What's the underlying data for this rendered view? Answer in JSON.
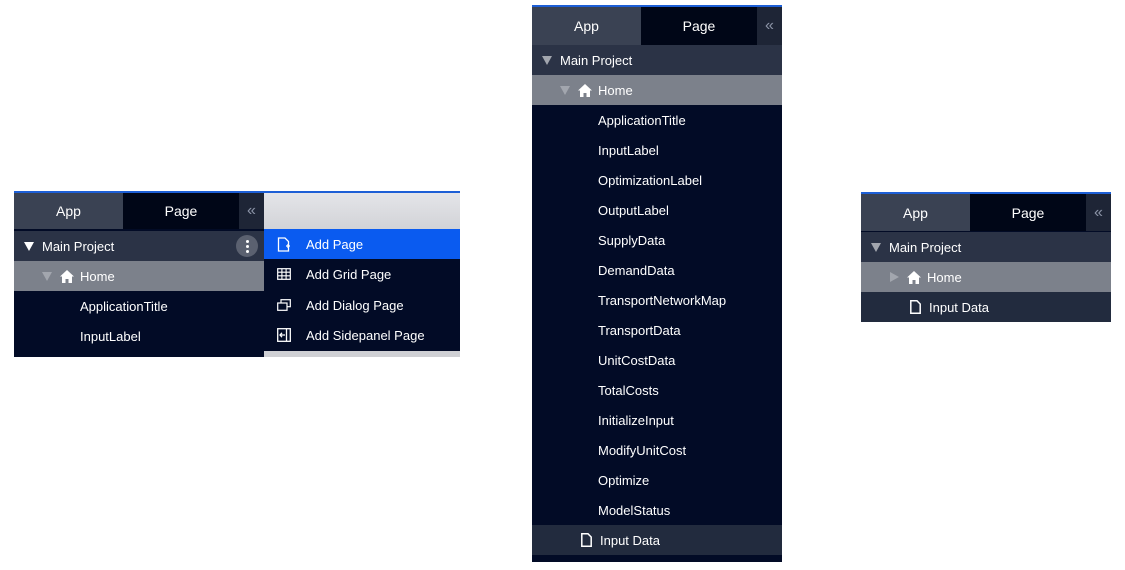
{
  "panel_left": {
    "tabs": {
      "app": "App",
      "page": "Page",
      "collapse": "«"
    },
    "tree": {
      "project": "Main Project",
      "home": "Home",
      "items": [
        "ApplicationTitle",
        "InputLabel"
      ]
    },
    "context_menu": {
      "items": [
        {
          "label": "Add Page",
          "icon": "add-page-icon",
          "active": true
        },
        {
          "label": "Add Grid Page",
          "icon": "grid-page-icon",
          "active": false
        },
        {
          "label": "Add Dialog Page",
          "icon": "dialog-page-icon",
          "active": false
        },
        {
          "label": "Add Sidepanel Page",
          "icon": "sidepanel-page-icon",
          "active": false
        }
      ]
    }
  },
  "panel_middle": {
    "tabs": {
      "app": "App",
      "page": "Page",
      "collapse": "«"
    },
    "tree": {
      "project": "Main Project",
      "home": "Home",
      "items": [
        "ApplicationTitle",
        "InputLabel",
        "OptimizationLabel",
        "OutputLabel",
        "SupplyData",
        "DemandData",
        "TransportNetworkMap",
        "TransportData",
        "UnitCostData",
        "TotalCosts",
        "InitializeInput",
        "ModifyUnitCost",
        "Optimize",
        "ModelStatus"
      ],
      "page": "Input Data"
    }
  },
  "panel_right": {
    "tabs": {
      "app": "App",
      "page": "Page",
      "collapse": "«"
    },
    "tree": {
      "project": "Main Project",
      "home": "Home",
      "page": "Input Data"
    }
  },
  "colors": {
    "accent": "#1d5fd6",
    "menu_active": "#0a5bf0",
    "panel_bg": "#020b26",
    "project_row": "#2b3346",
    "home_row": "#7c818b"
  }
}
